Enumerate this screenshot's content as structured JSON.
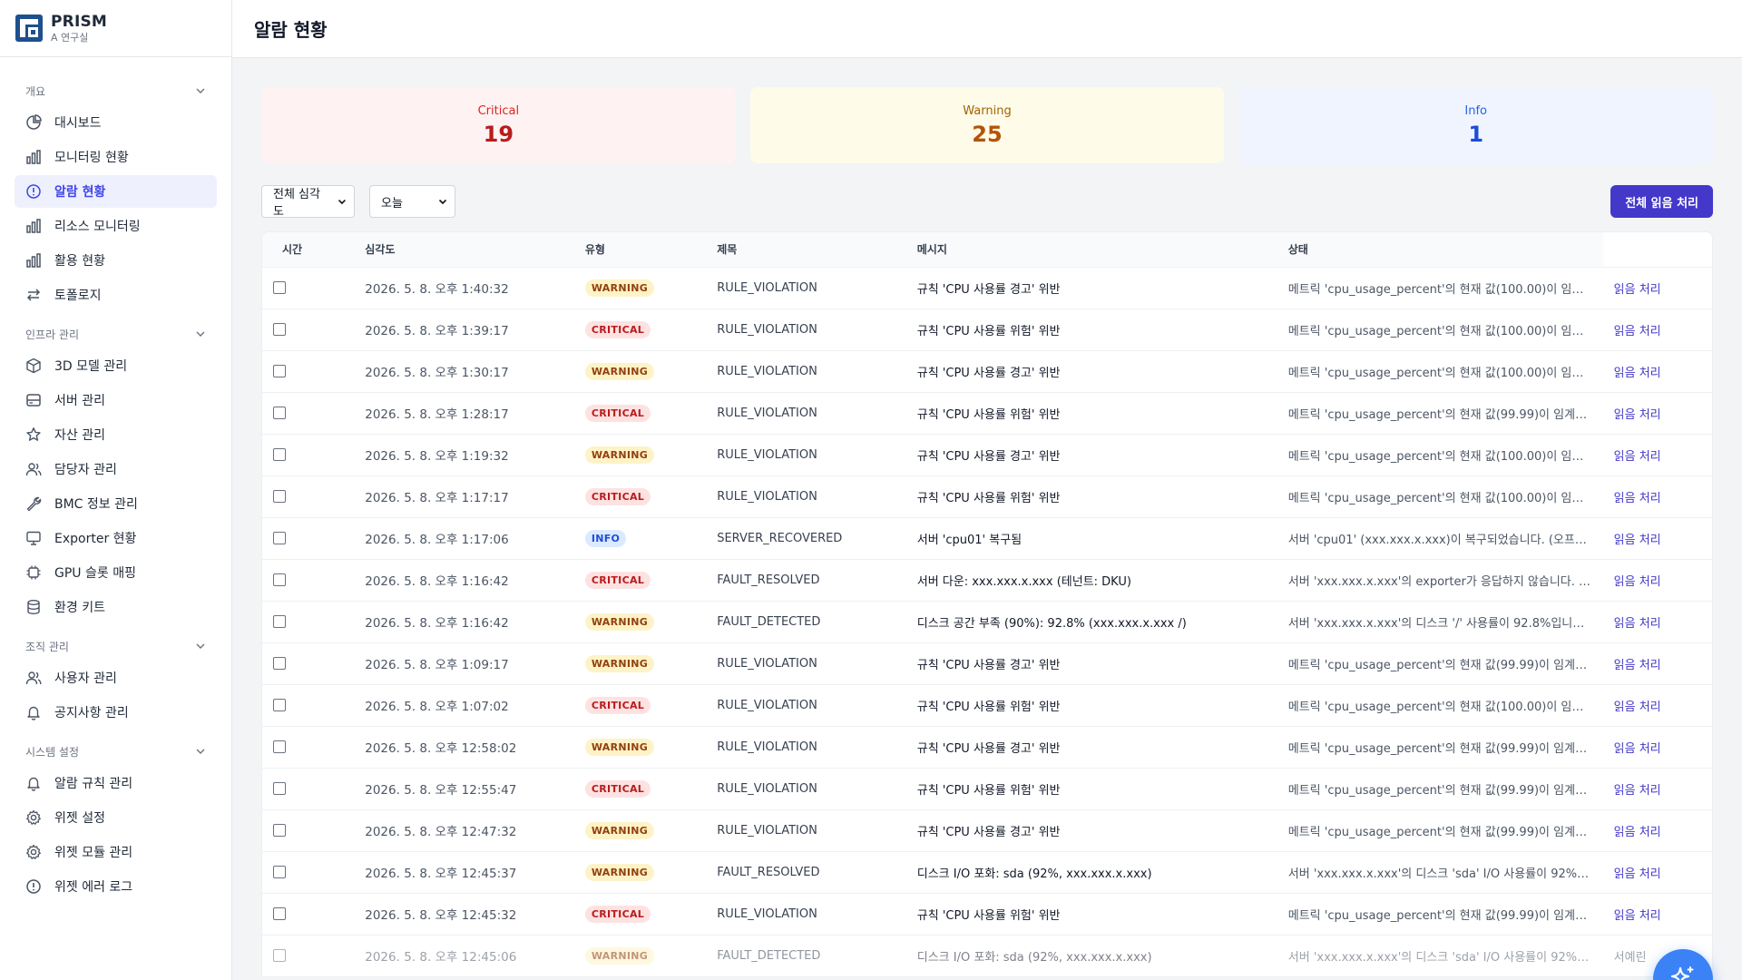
{
  "brand": {
    "name": "PRISM",
    "subtitle": "A 연구실"
  },
  "page": {
    "title": "알람 현황"
  },
  "sidebar": {
    "sections": [
      {
        "title": "개요",
        "items": [
          {
            "label": "대시보드",
            "icon": "pie-chart-icon"
          },
          {
            "label": "모니터링 현황",
            "icon": "bar-chart-icon"
          },
          {
            "label": "알람 현황",
            "icon": "alert-circle-icon",
            "active": true
          },
          {
            "label": "리소스 모니터링",
            "icon": "bar-chart-icon"
          },
          {
            "label": "활용 현황",
            "icon": "bar-chart-icon"
          },
          {
            "label": "토폴로지",
            "icon": "arrows-swap-icon"
          }
        ]
      },
      {
        "title": "인프라 관리",
        "items": [
          {
            "label": "3D 모델 관리",
            "icon": "cube-icon"
          },
          {
            "label": "서버 관리",
            "icon": "server-icon"
          },
          {
            "label": "자산 관리",
            "icon": "star-icon"
          },
          {
            "label": "담당자 관리",
            "icon": "users-icon"
          },
          {
            "label": "BMC 정보 관리",
            "icon": "wrench-icon"
          },
          {
            "label": "Exporter 현황",
            "icon": "monitor-icon"
          },
          {
            "label": "GPU 슬롯 매핑",
            "icon": "chip-icon"
          },
          {
            "label": "환경 키트",
            "icon": "database-icon"
          }
        ]
      },
      {
        "title": "조직 관리",
        "items": [
          {
            "label": "사용자 관리",
            "icon": "users-icon"
          },
          {
            "label": "공지사항 관리",
            "icon": "bell-icon"
          }
        ]
      },
      {
        "title": "시스템 설정",
        "items": [
          {
            "label": "알람 규칙 관리",
            "icon": "bell-icon"
          },
          {
            "label": "위젯 설정",
            "icon": "gear-icon"
          },
          {
            "label": "위젯 모듈 관리",
            "icon": "gear-icon"
          },
          {
            "label": "위젯 에러 로그",
            "icon": "alert-circle-icon"
          }
        ]
      }
    ]
  },
  "stats": {
    "critical": {
      "label": "Critical",
      "value": "19"
    },
    "warning": {
      "label": "Warning",
      "value": "25"
    },
    "info": {
      "label": "Info",
      "value": "1"
    }
  },
  "filters": {
    "severity": {
      "selected": "전체 심각도"
    },
    "period": {
      "selected": "오늘"
    }
  },
  "toolbar": {
    "read_all_label": "전체 읽음 처리"
  },
  "table": {
    "headers": {
      "time": "시간",
      "severity": "심각도",
      "type": "유형",
      "title": "제목",
      "message": "메시지",
      "status": "상태"
    },
    "rows": [
      {
        "time": "2026. 5. 8. 오후 1:40:32",
        "severity": "WARNING",
        "type": "RULE_VIOLATION",
        "title": "규칙 'CPU 사용률 경고' 위반",
        "message": "메트릭 'cpu_usage_percent'의 현재 값(100.00)이 임계...",
        "action": "읽음 처리"
      },
      {
        "time": "2026. 5. 8. 오후 1:39:17",
        "severity": "CRITICAL",
        "type": "RULE_VIOLATION",
        "title": "규칙 'CPU 사용률 위험' 위반",
        "message": "메트릭 'cpu_usage_percent'의 현재 값(100.00)이 임계...",
        "action": "읽음 처리"
      },
      {
        "time": "2026. 5. 8. 오후 1:30:17",
        "severity": "WARNING",
        "type": "RULE_VIOLATION",
        "title": "규칙 'CPU 사용률 경고' 위반",
        "message": "메트릭 'cpu_usage_percent'의 현재 값(100.00)이 임계...",
        "action": "읽음 처리"
      },
      {
        "time": "2026. 5. 8. 오후 1:28:17",
        "severity": "CRITICAL",
        "type": "RULE_VIOLATION",
        "title": "규칙 'CPU 사용률 위험' 위반",
        "message": "메트릭 'cpu_usage_percent'의 현재 값(99.99)이 임계값...",
        "action": "읽음 처리"
      },
      {
        "time": "2026. 5. 8. 오후 1:19:32",
        "severity": "WARNING",
        "type": "RULE_VIOLATION",
        "title": "규칙 'CPU 사용률 경고' 위반",
        "message": "메트릭 'cpu_usage_percent'의 현재 값(100.00)이 임계...",
        "action": "읽음 처리"
      },
      {
        "time": "2026. 5. 8. 오후 1:17:17",
        "severity": "CRITICAL",
        "type": "RULE_VIOLATION",
        "title": "규칙 'CPU 사용률 위험' 위반",
        "message": "메트릭 'cpu_usage_percent'의 현재 값(100.00)이 임계...",
        "action": "읽음 처리"
      },
      {
        "time": "2026. 5. 8. 오후 1:17:06",
        "severity": "INFO",
        "type": "SERVER_RECOVERED",
        "title": "서버 'cpu01' 복구됨",
        "message": "서버 'cpu01' (xxx.xxx.x.xxx)이 복구되었습니다. (오프라...",
        "action": "읽음 처리"
      },
      {
        "time": "2026. 5. 8. 오후 1:16:42",
        "severity": "CRITICAL",
        "type": "FAULT_RESOLVED",
        "title": "서버 다운: xxx.xxx.x.xxx (테넌트: DKU)",
        "message": "서버 'xxx.xxx.x.xxx'의 exporter가 응답하지 않습니다. (u...",
        "action": "읽음 처리"
      },
      {
        "time": "2026. 5. 8. 오후 1:16:42",
        "severity": "WARNING",
        "type": "FAULT_DETECTED",
        "title": "디스크 공간 부족 (90%): 92.8% (xxx.xxx.x.xxx /)",
        "message": "서버 'xxx.xxx.x.xxx'의 디스크 '/' 사용률이 92.8%입니다. (...",
        "action": "읽음 처리"
      },
      {
        "time": "2026. 5. 8. 오후 1:09:17",
        "severity": "WARNING",
        "type": "RULE_VIOLATION",
        "title": "규칙 'CPU 사용률 경고' 위반",
        "message": "메트릭 'cpu_usage_percent'의 현재 값(99.99)이 임계값...",
        "action": "읽음 처리"
      },
      {
        "time": "2026. 5. 8. 오후 1:07:02",
        "severity": "CRITICAL",
        "type": "RULE_VIOLATION",
        "title": "규칙 'CPU 사용률 위험' 위반",
        "message": "메트릭 'cpu_usage_percent'의 현재 값(100.00)이 임계...",
        "action": "읽음 처리"
      },
      {
        "time": "2026. 5. 8. 오후 12:58:02",
        "severity": "WARNING",
        "type": "RULE_VIOLATION",
        "title": "규칙 'CPU 사용률 경고' 위반",
        "message": "메트릭 'cpu_usage_percent'의 현재 값(99.99)이 임계값...",
        "action": "읽음 처리"
      },
      {
        "time": "2026. 5. 8. 오후 12:55:47",
        "severity": "CRITICAL",
        "type": "RULE_VIOLATION",
        "title": "규칙 'CPU 사용률 위험' 위반",
        "message": "메트릭 'cpu_usage_percent'의 현재 값(99.99)이 임계값...",
        "action": "읽음 처리"
      },
      {
        "time": "2026. 5. 8. 오후 12:47:32",
        "severity": "WARNING",
        "type": "RULE_VIOLATION",
        "title": "규칙 'CPU 사용률 경고' 위반",
        "message": "메트릭 'cpu_usage_percent'의 현재 값(99.99)이 임계값...",
        "action": "읽음 처리"
      },
      {
        "time": "2026. 5. 8. 오후 12:45:37",
        "severity": "WARNING",
        "type": "FAULT_RESOLVED",
        "title": "디스크 I/O 포화: sda (92%, xxx.xxx.x.xxx)",
        "message": "서버 'xxx.xxx.x.xxx'의 디스크 'sda' I/O 사용률이 92%입...",
        "action": "읽음 처리"
      },
      {
        "time": "2026. 5. 8. 오후 12:45:32",
        "severity": "CRITICAL",
        "type": "RULE_VIOLATION",
        "title": "규칙 'CPU 사용률 위험' 위반",
        "message": "메트릭 'cpu_usage_percent'의 현재 값(99.99)이 임계값...",
        "action": "읽음 처리"
      },
      {
        "time": "2026. 5. 8. 오후 12:45:06",
        "severity": "WARNING",
        "type": "FAULT_DETECTED",
        "title": "디스크 I/O 포화: sda (92%, xxx.xxx.x.xxx)",
        "message": "서버 'xxx.xxx.x.xxx'의 디스크 'sda' I/O 사용률이 92%입...",
        "action": "서예린",
        "dim": true
      }
    ]
  },
  "fab": {
    "icon": "sparkles-icon"
  }
}
